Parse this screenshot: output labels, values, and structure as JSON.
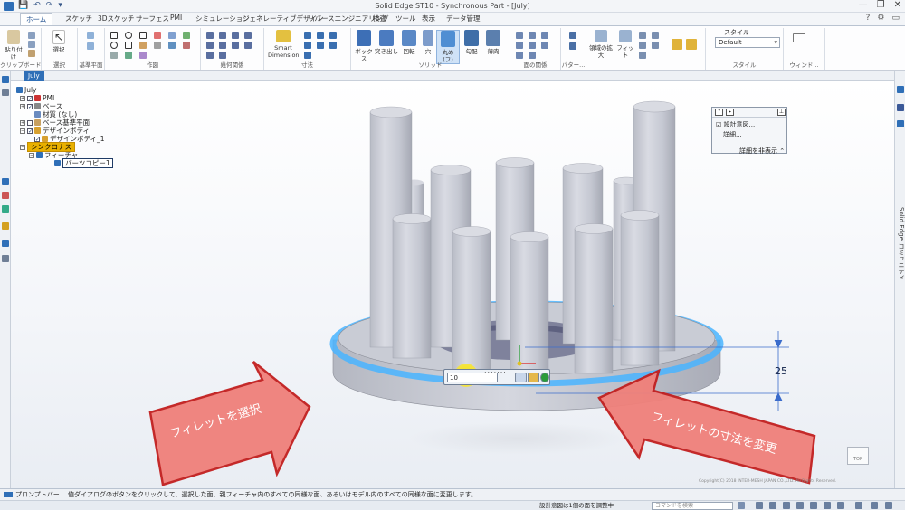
{
  "window": {
    "title": "Solid Edge ST10 - Synchronous Part - [July]",
    "qat": [
      "💾",
      "↶",
      "↷",
      "▾"
    ],
    "controls": [
      "—",
      "❐",
      "✕"
    ]
  },
  "ribbon": {
    "tabs": [
      "ホーム",
      "スケッチ",
      "3Dスケッチ",
      "サーフェス",
      "PMI",
      "シミュレーション",
      "ジェネレーティブデザイン",
      "リバースエンジニアリング",
      "検査",
      "ツール",
      "表示",
      "データ管理"
    ],
    "active_tab": "ホーム",
    "groups": {
      "clipboard": {
        "label": "クリップボード",
        "paste": "貼り付け"
      },
      "select": {
        "label": "選択",
        "select": "選択"
      },
      "plane": {
        "label": "基準平面"
      },
      "draw": {
        "label": "作図"
      },
      "relations": {
        "label": "幾何関係"
      },
      "dimension": {
        "label": "寸法",
        "smart": "Smart Dimension"
      },
      "solids": {
        "label": "ソリッド",
        "box": "ボックス",
        "extrude": "突き出し",
        "revolve": "回転",
        "hole": "穴",
        "round": "丸め(フ)",
        "draft": "勾配",
        "thin": "薄肉"
      },
      "face_rel": {
        "label": "面の関係"
      },
      "pattern": {
        "label": "パター..."
      },
      "orient": {
        "label": "",
        "zoom_area": "領域の拡大",
        "fit": "フィット"
      },
      "style": {
        "label": "スタイル",
        "style_title": "スタイル",
        "style_value": "Default"
      },
      "window": {
        "label": "ウィンド..."
      }
    }
  },
  "doc_tab": "July",
  "tree": {
    "root": "July",
    "items": [
      {
        "label": "PMI"
      },
      {
        "label": "ベース"
      },
      {
        "label": "材質 (なし)"
      },
      {
        "label": "ベース基準平面"
      },
      {
        "label": "デザインボディ"
      },
      {
        "label": "デザインボディ_1"
      },
      {
        "label": "シンクロナス"
      },
      {
        "label": "フィーチャ"
      },
      {
        "label": "パーツコピー1"
      }
    ]
  },
  "properties_panel": {
    "buttons": [
      "?",
      "▸",
      "⊥"
    ],
    "design_intent": "設計意図...",
    "details": "詳細...",
    "hide_details": "詳細を非表示"
  },
  "fillet_dialog": {
    "value": "10",
    "dots": "......."
  },
  "dimension_value": "25",
  "callouts": {
    "left": "フィレットを選択",
    "right": "フィレットの寸法を変更"
  },
  "view_cube": "TOP",
  "copyright": "Copyright(C) 2018 INTER-MESH JAPAN CO.,LTD. All Rights Reserved.",
  "prompt_bar": {
    "label": "プロンプトバー",
    "message": "値ダイアログのボタンをクリックして、選択した面、親フィーチャ内のすべての同様な面、あるいはモデル内のすべての同様な面に変更します。"
  },
  "bottom_status": {
    "status": "設計意図は1個の面を調整中",
    "command_placeholder": "コマンドを検索"
  },
  "right_panel_text": "Solid Edge コミュニティ",
  "colors": {
    "arrow_fill": "#f0807a",
    "arrow_edge": "#c21f1f",
    "accent": "#2f6fb7",
    "highlight_ring": "#49b4ff"
  }
}
